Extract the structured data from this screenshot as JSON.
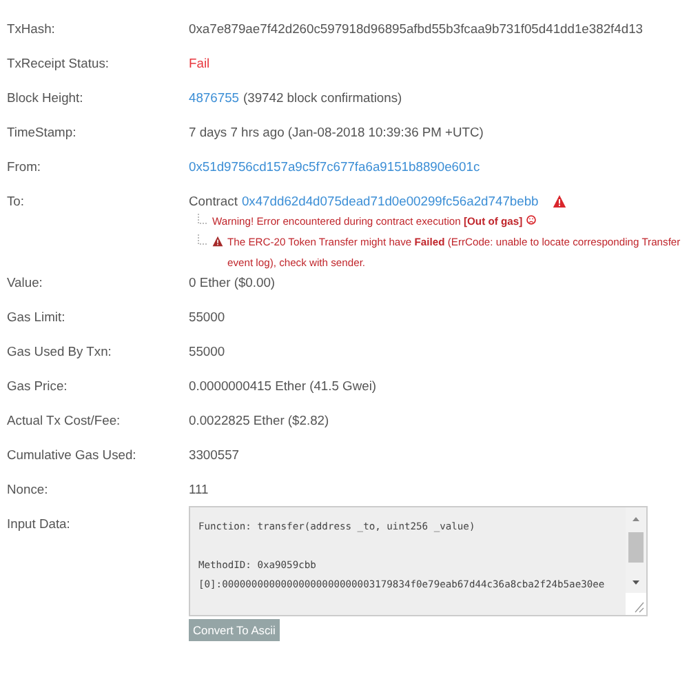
{
  "rows": [
    {
      "kind": "text",
      "label": "TxHash:",
      "value": "0xa7e879ae7f42d260c597918d96895afbd55b3fcaa9b731f05d41dd1e382f4d13"
    },
    {
      "kind": "status",
      "label": "TxReceipt Status:",
      "value": "Fail"
    },
    {
      "kind": "block",
      "label": "Block Height:",
      "link": "4876755",
      "value": "(39742 block confirmations)"
    },
    {
      "kind": "text",
      "label": "TimeStamp:",
      "value": "7 days 7 hrs ago (Jan-08-2018 10:39:36 PM +UTC)"
    },
    {
      "kind": "link",
      "label": "From:",
      "value": "0x51d9756cd157a9c5f7c677fa6a9151b8890e601c"
    },
    {
      "kind": "contract",
      "label": "To:",
      "prefix": "Contract",
      "link": "0x47dd62d4d075dead71d0e00299fc56a2d747bebb",
      "warnings": [
        "Warning! Error encountered during contract execution **[Out of gas]**",
        "The ERC-20 Token Transfer might have **Failed** (ErrCode: unable to locate corresponding Transfer event log), check with sender."
      ]
    },
    {
      "kind": "text",
      "label": "Value:",
      "value": "0 Ether ($0.00)"
    },
    {
      "kind": "text",
      "label": "Gas Limit:",
      "value": "55000"
    },
    {
      "kind": "text",
      "label": "Gas Used By Txn:",
      "value": "55000"
    },
    {
      "kind": "text",
      "label": "Gas Price:",
      "value": "0.0000000415 Ether (41.5 Gwei)"
    },
    {
      "kind": "text",
      "label": "Actual Tx Cost/Fee:",
      "value": "0.0022825 Ether ($2.82)"
    },
    {
      "kind": "text",
      "label": "Cumulative Gas Used:",
      "value": "3300557"
    },
    {
      "kind": "text",
      "label": "Nonce:",
      "value": "111"
    },
    {
      "kind": "input",
      "label": "Input Data:",
      "lines": [
        "Function: transfer(address _to, uint256 _value)",
        "MethodID: 0xa9059cbb",
        "[0]:00000000000000000000000003179834f0e79eab67d44c36a8cba2f24b5ae30ee"
      ],
      "button": "Convert To Ascii"
    }
  ]
}
